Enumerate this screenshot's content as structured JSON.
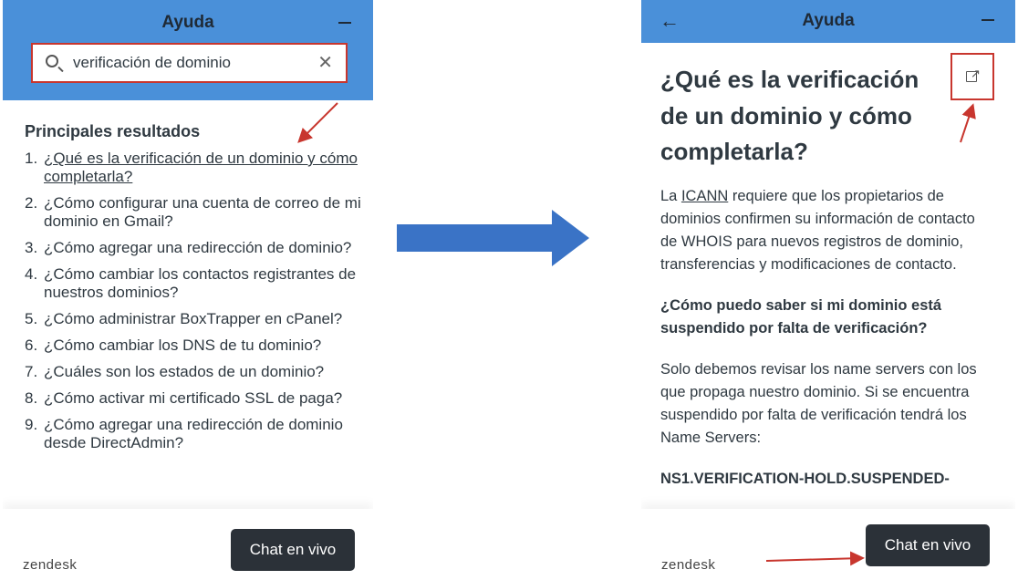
{
  "left_panel": {
    "header_title": "Ayuda",
    "search": {
      "value": "verificación de dominio"
    },
    "results_title": "Principales resultados",
    "results": [
      {
        "num": "1.",
        "text": "¿Qué es la verificación de un dominio y cómo completarla?"
      },
      {
        "num": "2.",
        "text": " ¿Cómo configurar una cuenta de correo de mi dominio en Gmail?"
      },
      {
        "num": "3.",
        "text": "¿Cómo agregar una redirección de dominio?"
      },
      {
        "num": "4.",
        "text": "¿Cómo cambiar los contactos registrantes de nuestros dominios?"
      },
      {
        "num": "5.",
        "text": " ¿Cómo administrar BoxTrapper en cPanel?"
      },
      {
        "num": "6.",
        "text": "¿Cómo cambiar los DNS de tu dominio?"
      },
      {
        "num": "7.",
        "text": "¿Cuáles son los estados de un dominio?"
      },
      {
        "num": "8.",
        "text": "¿Cómo activar mi certificado SSL de paga?"
      },
      {
        "num": "9.",
        "text": "¿Cómo agregar una redirección de dominio desde DirectAdmin?"
      }
    ],
    "footer_brand": "zendesk",
    "chat_button": "Chat en vivo"
  },
  "right_panel": {
    "header_title": "Ayuda",
    "article_title": "¿Qué es la verificación de un dominio y cómo completarla?",
    "p1_pre": "La ",
    "p1_link": "ICANN",
    "p1_post": " requiere que los propietarios de dominios confirmen su información de contacto de WHOIS para nuevos registros de dominio, transferencias y modificaciones de contacto.",
    "question": "¿Cómo puedo saber si mi dominio está suspendido por falta de verificación?",
    "p2": "Solo debemos revisar los name servers con los que propaga nuestro dominio. Si se encuentra suspendido por falta de verificación tendrá los Name Servers:",
    "nameserver": "NS1.VERIFICATION-HOLD.SUSPENDED-",
    "footer_brand": "zendesk",
    "chat_button": "Chat en vivo"
  },
  "icons": {
    "back": "arrow-left-icon",
    "minimize": "minimize-icon",
    "search": "search-icon",
    "clear": "close-icon",
    "external": "external-link-icon"
  },
  "colors": {
    "header": "#4a90d9",
    "highlight": "#c8362e",
    "arrow": "#3a73c6",
    "chat_button": "#2b3138"
  }
}
